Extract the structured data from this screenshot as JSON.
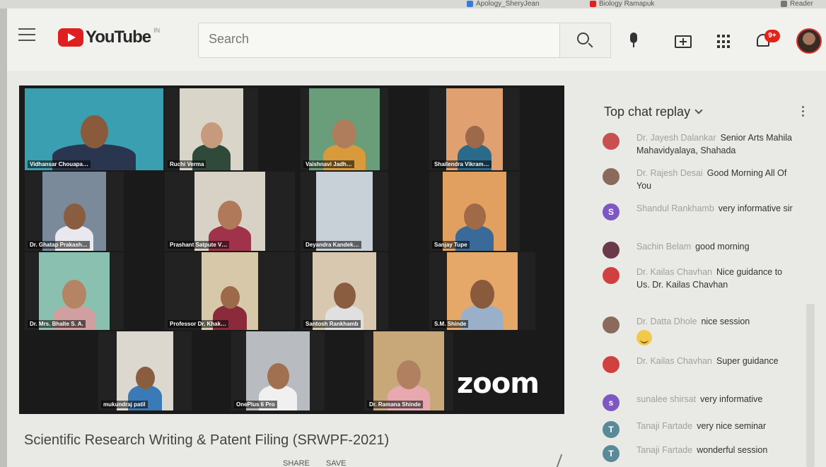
{
  "browser": {
    "bookmarks": [
      "Apology_SheryJean",
      "Biology Ramapuk",
      "Reader"
    ]
  },
  "header": {
    "logo_text": "YouTube",
    "logo_region": "IN",
    "search_placeholder": "Search",
    "notification_count": "9+"
  },
  "video": {
    "title": "Scientific Research Writing & Patent Filing (SRWPF-2021)",
    "watermark": "zoom",
    "actions": [
      "",
      "",
      "SHARE",
      "SAVE"
    ],
    "participants": [
      {
        "name": "Vidhansar Chouapa…",
        "bg": "#3a9fb0",
        "skin": "#8a5a3c",
        "shirt": "#2a3550"
      },
      {
        "name": "Ruchi Verma",
        "bg": "#d9d5c8",
        "skin": "#c79a7d",
        "shirt": "#2f4a3a"
      },
      {
        "name": "Vaishnavi Jadh…",
        "bg": "#6a9e7a",
        "skin": "#b07d5c",
        "shirt": "#d89a3a"
      },
      {
        "name": "Shailendra Vikram…",
        "bg": "#e0a070",
        "skin": "#9c6a4a",
        "shirt": "#2a6a8a"
      },
      {
        "name": "Dr. Ghatap Prakash…",
        "bg": "#7a8a9a",
        "skin": "#8a5c40",
        "shirt": "#e8e8ee"
      },
      {
        "name": "Prashant Satpute V…",
        "bg": "#d8d2c6",
        "skin": "#b07a5a",
        "shirt": "#a0334a"
      },
      {
        "name": "Deyandra Kandek…",
        "bg": "#c8d0d8",
        "skin": "#c8d0d8",
        "shirt": "#c8d0d8"
      },
      {
        "name": "Sanjay Tupe",
        "bg": "#e2a060",
        "skin": "#a06a48",
        "shirt": "#3a6a9a"
      },
      {
        "name": "Dr. Mrs. Bhalte S. A.",
        "bg": "#8ac0b0",
        "skin": "#b48464",
        "shirt": "#d0a0a0"
      },
      {
        "name": "Professor Dr. Khak…",
        "bg": "#d6c8a8",
        "skin": "#9c6a4a",
        "shirt": "#8a2a3a"
      },
      {
        "name": "Santosh Rankhamb",
        "bg": "#d8c8b0",
        "skin": "#8a5c40",
        "shirt": "#e0e0e0"
      },
      {
        "name": "S.M. Shinde",
        "bg": "#e6a868",
        "skin": "#8a5a3c",
        "shirt": "#9ab0c8"
      },
      {
        "name": "mukundraj patil",
        "bg": "#dcd8d0",
        "skin": "#8a5c40",
        "shirt": "#3a7ab8"
      },
      {
        "name": "OnePlus 6 Pro",
        "bg": "#b8bcc0",
        "skin": "#a07050",
        "shirt": "#f0f0f0"
      },
      {
        "name": "Dr. Ramana Shinde",
        "bg": "#c8a878",
        "skin": "#b08060",
        "shirt": "#e8a8b0"
      }
    ]
  },
  "chat": {
    "header": "Top chat replay",
    "messages": [
      {
        "author": "Dr. Jayesh Dalankar",
        "text": "Senior Arts Mahila Mahavidyalaya, Shahada",
        "avatar_color": "#c95050",
        "initial": ""
      },
      {
        "author": "Dr. Rajesh Desai",
        "text": "Good Morning All Of You",
        "avatar_color": "#8a6a5a",
        "initial": ""
      },
      {
        "author": "Shandul Rankhamb",
        "text": "very informative sir",
        "avatar_color": "#7e57c2",
        "initial": "S"
      },
      {
        "author": "Sachin Belam",
        "text": "good morning",
        "avatar_color": "#6a3a4a",
        "initial": ""
      },
      {
        "author": "Dr. Kailas Chavhan",
        "text": "Nice guidance to Us. Dr. Kailas Chavhan",
        "avatar_color": "#d04040",
        "initial": ""
      },
      {
        "author": "Dr. Datta Dhole",
        "text": "nice session",
        "avatar_color": "#8a6a5a",
        "initial": ""
      },
      {
        "author": "Dr. Kailas Chavhan",
        "text": "Super guidance",
        "avatar_color": "#d04040",
        "initial": ""
      },
      {
        "author": "sunalee shirsat",
        "text": "very informative",
        "avatar_color": "#7e57c2",
        "initial": "s"
      },
      {
        "author": "Tanaji Fartade",
        "text": "very nice seminar",
        "avatar_color": "#5a8a9a",
        "initial": "T"
      },
      {
        "author": "Tanaji Fartade",
        "text": "wonderful session",
        "avatar_color": "#5a8a9a",
        "initial": "T"
      }
    ]
  }
}
